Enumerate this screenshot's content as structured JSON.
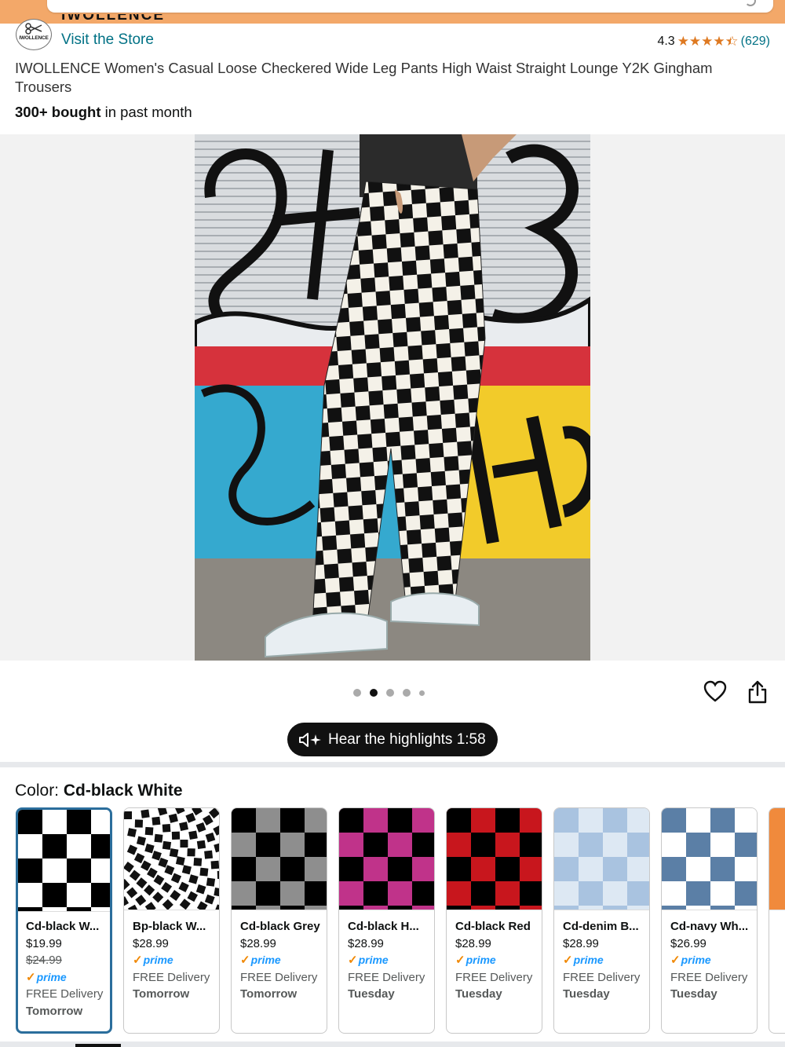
{
  "store": {
    "name": "IWOLLENCE",
    "logo_text": "IWOLLENCE",
    "visit_label": "Visit the Store"
  },
  "rating": {
    "value": "4.3",
    "stars": 4.3,
    "count": "(629)"
  },
  "product": {
    "title": "IWOLLENCE Women's Casual Loose Checkered Wide Leg Pants High Waist Straight Lounge Y2K Gingham Trousers",
    "bought_bold": "300+ bought",
    "bought_rest": " in past month"
  },
  "gallery": {
    "image_count": 5,
    "active_index": 1
  },
  "highlights": {
    "label": "Hear the highlights 1:58"
  },
  "color": {
    "label": "Color: ",
    "selected": "Cd-black White"
  },
  "swatches": [
    {
      "name": "Cd-black W...",
      "price": "$19.99",
      "list_price": "$24.99",
      "prime": "prime",
      "delivery": "FREE Delivery",
      "when": "Tomorrow",
      "colors": [
        "#000000",
        "#ffffff"
      ]
    },
    {
      "name": "Bp-black W...",
      "price": "$28.99",
      "prime": "prime",
      "delivery": "FREE Delivery",
      "when": "Tomorrow",
      "colors": [
        "#111111",
        "#ffffff"
      ]
    },
    {
      "name": "Cd-black Grey",
      "price": "$28.99",
      "prime": "prime",
      "delivery": "FREE Delivery",
      "when": "Tomorrow",
      "colors": [
        "#000000",
        "#8e8e8e"
      ]
    },
    {
      "name": "Cd-black H...",
      "price": "$28.99",
      "prime": "prime",
      "delivery": "FREE Delivery",
      "when": "Tuesday",
      "colors": [
        "#000000",
        "#c0338a"
      ]
    },
    {
      "name": "Cd-black Red",
      "price": "$28.99",
      "prime": "prime",
      "delivery": "FREE Delivery",
      "when": "Tuesday",
      "colors": [
        "#000000",
        "#c8161d"
      ]
    },
    {
      "name": "Cd-denim B...",
      "price": "$28.99",
      "prime": "prime",
      "delivery": "FREE Delivery",
      "when": "Tuesday",
      "colors": [
        "#a9c3e0",
        "#dde8f3"
      ]
    },
    {
      "name": "Cd-navy Wh...",
      "price": "$26.99",
      "prime": "prime",
      "delivery": "FREE Delivery",
      "when": "Tuesday",
      "colors": [
        "#5b7fa6",
        "#ffffff"
      ]
    }
  ],
  "accent_colors": {
    "header_bar": "#f3a869",
    "link": "#007185",
    "star": "#de7921",
    "prime": "#1a98ff",
    "selected_border": "#2b6e9c"
  }
}
